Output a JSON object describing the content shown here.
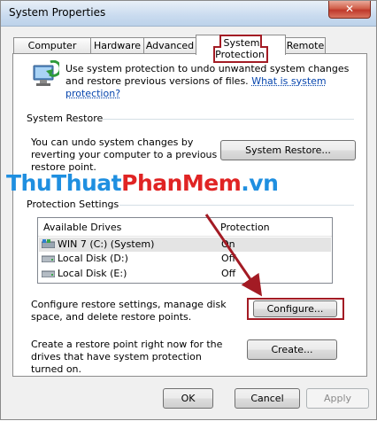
{
  "window": {
    "title": "System Properties",
    "close_glyph": "✕"
  },
  "tabs": [
    {
      "label": "Computer Name"
    },
    {
      "label": "Hardware"
    },
    {
      "label": "Advanced"
    },
    {
      "label": "System Protection"
    },
    {
      "label": "Remote"
    }
  ],
  "protection_intro": {
    "text": "Use system protection to undo unwanted system changes and restore previous versions of files.",
    "link": "What is system protection?"
  },
  "system_restore": {
    "group_label": "System Restore",
    "description": "You can undo system changes by reverting your computer to a previous restore point.",
    "button_label": "System Restore..."
  },
  "watermark": {
    "part1": "ThuThuat",
    "part2": "PhanMem",
    "part3": ".vn"
  },
  "protection_settings": {
    "group_label": "Protection Settings",
    "columns": [
      "Available Drives",
      "Protection"
    ],
    "drives": [
      {
        "name": "WIN 7 (C:) (System)",
        "protection": "On",
        "icon": "system-drive-icon"
      },
      {
        "name": "Local Disk (D:)",
        "protection": "Off",
        "icon": "local-disk-icon"
      },
      {
        "name": "Local Disk (E:)",
        "protection": "Off",
        "icon": "local-disk-icon"
      }
    ],
    "configure_text": "Configure restore settings, manage disk space, and delete restore points.",
    "configure_button": "Configure...",
    "create_text": "Create a restore point right now for the drives that have system protection turned on.",
    "create_button": "Create..."
  },
  "footer": {
    "ok": "OK",
    "cancel": "Cancel",
    "apply": "Apply"
  },
  "colors": {
    "highlight": "#a31b24",
    "link": "#0645ad",
    "watermark_blue": "#1f8fe0",
    "watermark_red": "#e02424"
  }
}
